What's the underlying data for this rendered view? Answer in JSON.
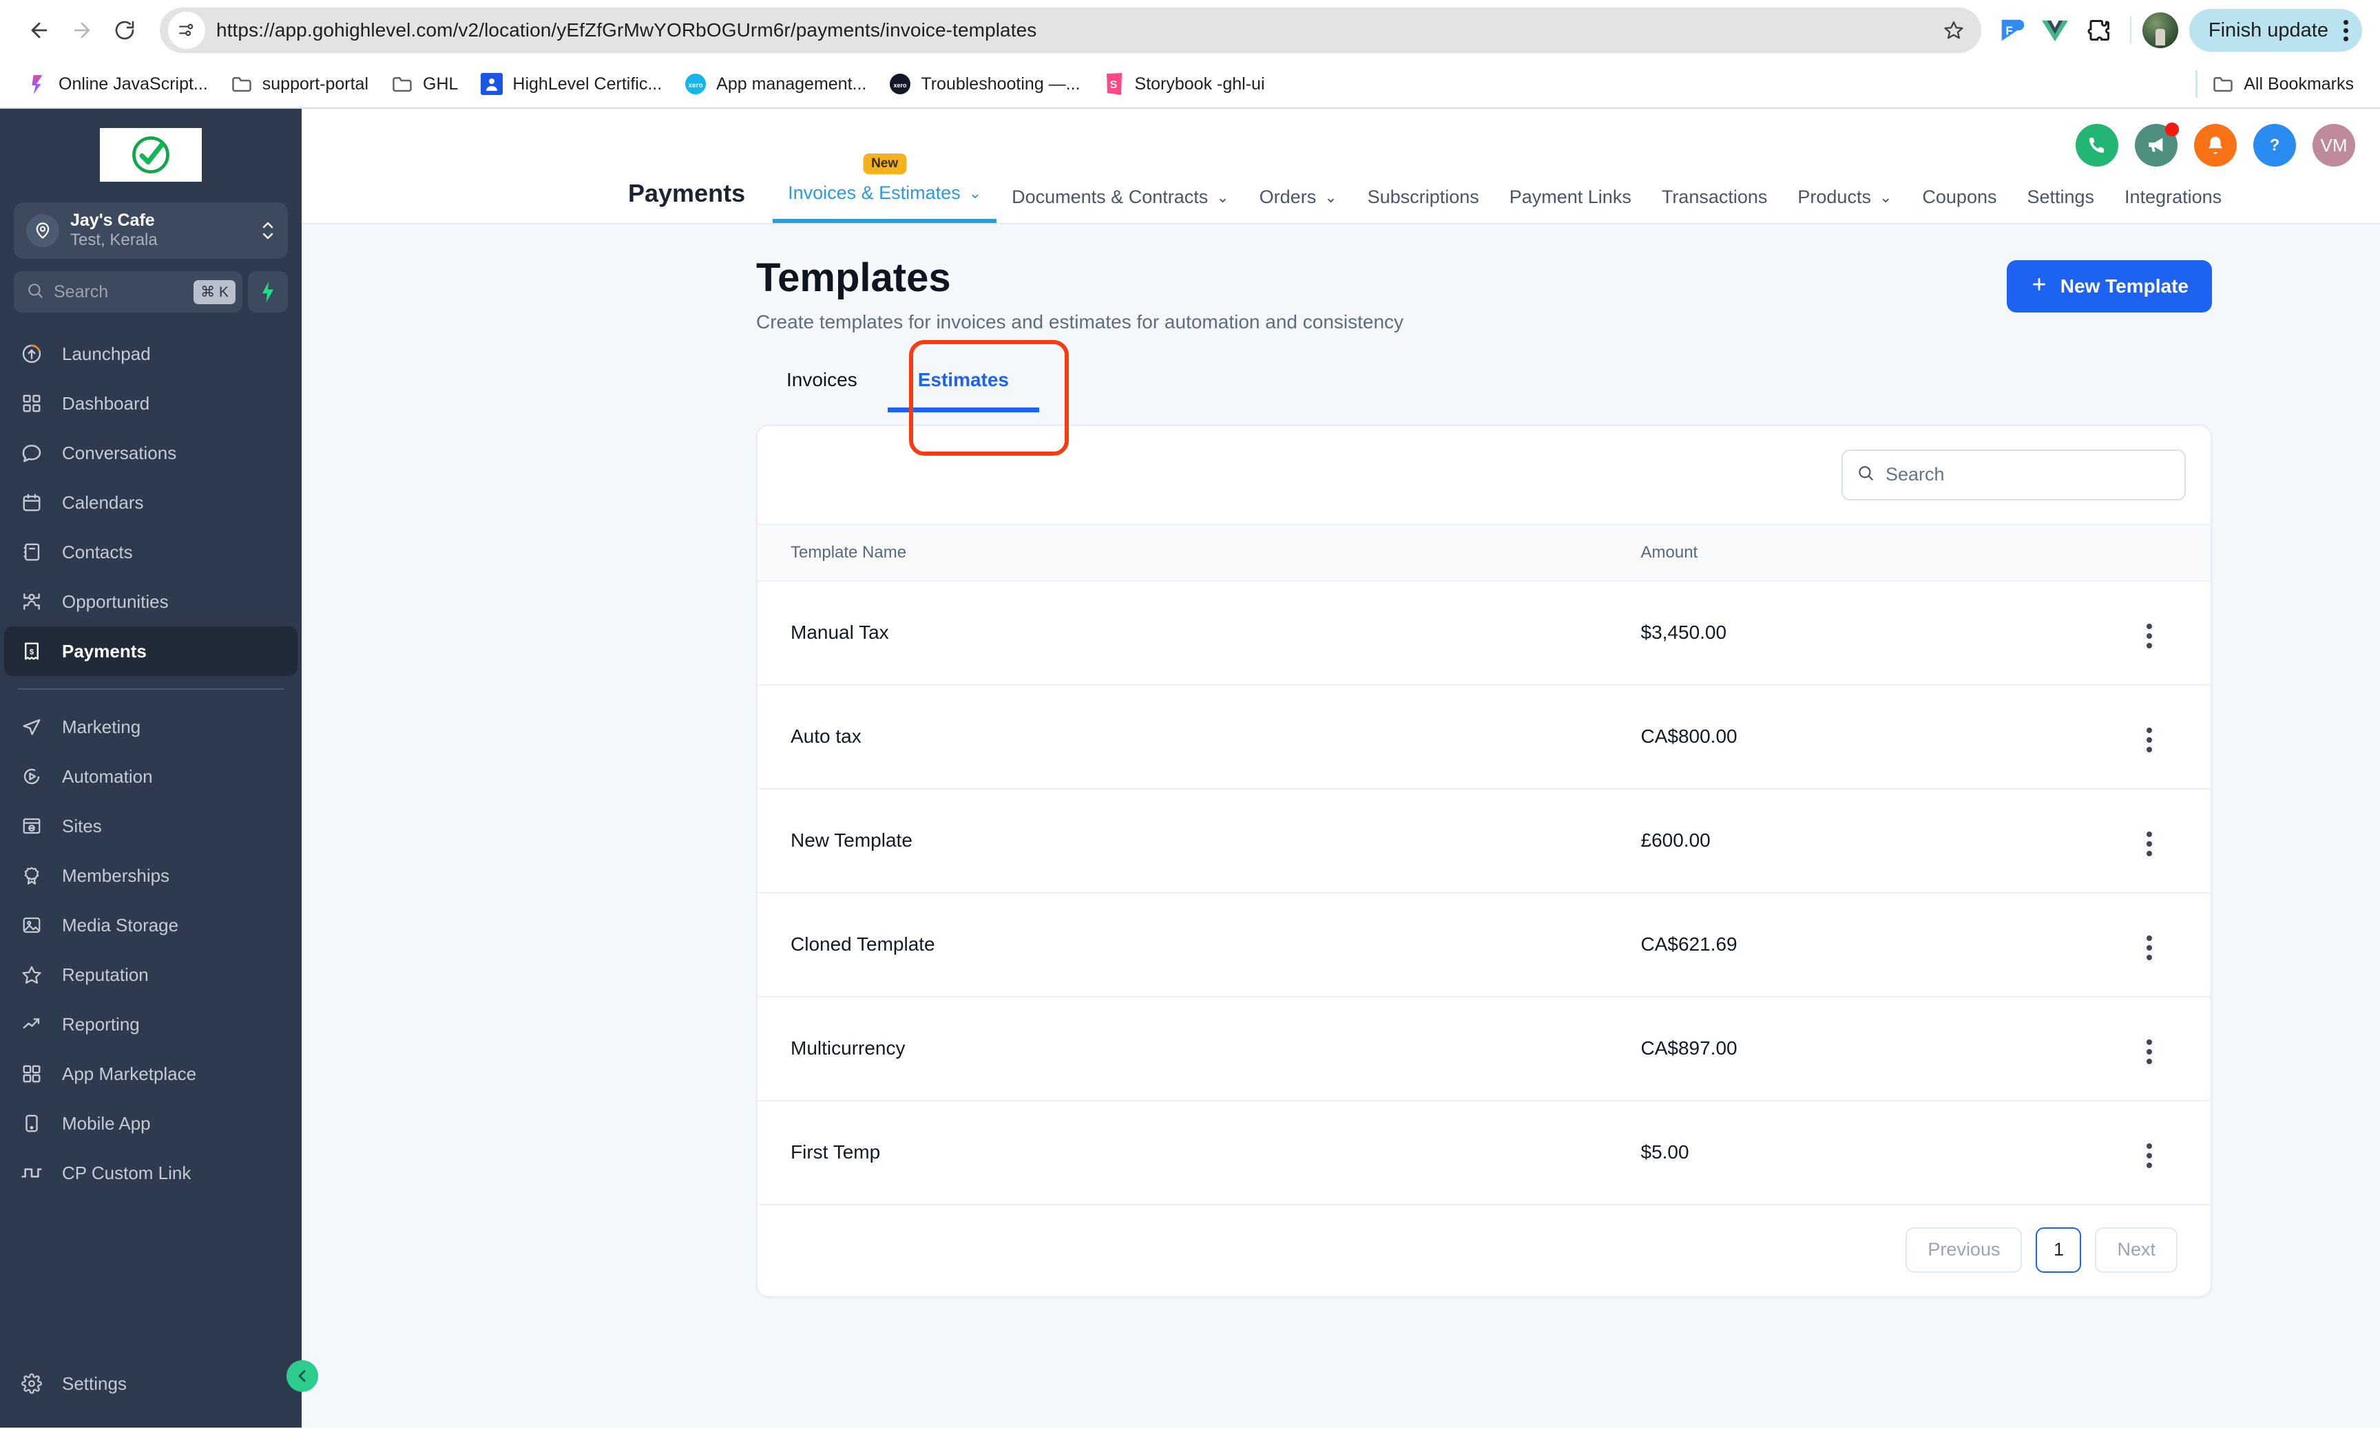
{
  "browser": {
    "url": "https://app.gohighlevel.com/v2/location/yEfZfGrMwYORbOGUrm6r/payments/invoice-templates",
    "back_icon": "back-arrow-icon",
    "forward_icon": "forward-arrow-icon",
    "reload_icon": "reload-icon",
    "site_info_icon": "site-settings-icon",
    "bookmark_star_icon": "bookmark-star-icon",
    "finish_update_label": "Finish update",
    "extensions": [
      {
        "name": "figma-extension-icon",
        "glyph": "F"
      },
      {
        "name": "vue-devtools-icon",
        "glyph": "V"
      },
      {
        "name": "extensions-puzzle-icon",
        "glyph": "puzzle"
      }
    ],
    "bookmarks": [
      {
        "label": "Online JavaScript...",
        "icon": "js-playground-icon"
      },
      {
        "label": "support-portal",
        "icon": "folder-icon"
      },
      {
        "label": "GHL",
        "icon": "folder-icon"
      },
      {
        "label": "HighLevel Certific...",
        "icon": "highlevel-icon"
      },
      {
        "label": "App management...",
        "icon": "xero-icon"
      },
      {
        "label": "Troubleshooting —...",
        "icon": "xero-dark-icon"
      },
      {
        "label": "Storybook -ghl-ui",
        "icon": "storybook-icon"
      }
    ],
    "all_bookmarks_label": "All Bookmarks",
    "all_bookmarks_icon": "folder-icon"
  },
  "sidebar": {
    "logo_icon": "green-check-circle-logo",
    "location": {
      "name": "Jay's Cafe",
      "sub": "Test, Kerala",
      "avatar_icon": "location-pin-icon",
      "chevron_icon": "chevron-up-down-icon"
    },
    "search": {
      "placeholder": "Search",
      "icon": "search-icon",
      "shortcut": "⌘ K",
      "bolt_icon": "lightning-bolt-icon"
    },
    "items": [
      {
        "label": "Launchpad",
        "icon": "launchpad-icon",
        "active": false
      },
      {
        "label": "Dashboard",
        "icon": "dashboard-grid-icon",
        "active": false
      },
      {
        "label": "Conversations",
        "icon": "chat-bubble-icon",
        "active": false
      },
      {
        "label": "Calendars",
        "icon": "calendar-icon",
        "active": false
      },
      {
        "label": "Contacts",
        "icon": "contacts-book-icon",
        "active": false
      },
      {
        "label": "Opportunities",
        "icon": "opportunities-icon",
        "active": false
      },
      {
        "label": "Payments",
        "icon": "payments-receipt-icon",
        "active": true
      }
    ],
    "items2": [
      {
        "label": "Marketing",
        "icon": "paper-plane-icon",
        "active": false
      },
      {
        "label": "Automation",
        "icon": "play-circle-icon",
        "active": false
      },
      {
        "label": "Sites",
        "icon": "browser-window-icon",
        "active": false
      },
      {
        "label": "Memberships",
        "icon": "award-ribbon-icon",
        "active": false
      },
      {
        "label": "Media Storage",
        "icon": "image-icon",
        "active": false
      },
      {
        "label": "Reputation",
        "icon": "star-icon",
        "active": false
      },
      {
        "label": "Reporting",
        "icon": "trend-up-icon",
        "active": false
      },
      {
        "label": "App Marketplace",
        "icon": "grid-apps-icon",
        "active": false
      },
      {
        "label": "Mobile App",
        "icon": "mobile-phone-icon",
        "active": false
      },
      {
        "label": "CP Custom Link",
        "icon": "custom-link-icon",
        "active": false
      }
    ],
    "settings": {
      "label": "Settings",
      "icon": "gear-icon"
    },
    "collapse_icon": "chevron-left-icon"
  },
  "topbar": {
    "icons": [
      {
        "name": "phone-icon",
        "color": "#22b573"
      },
      {
        "name": "megaphone-icon",
        "color": "#4f8f80",
        "badge": true
      },
      {
        "name": "bell-icon",
        "color": "#f97316"
      },
      {
        "name": "help-question-icon",
        "color": "#2a8cf0"
      }
    ],
    "avatar_initials": "VM",
    "avatar_color": "#bf8a9b"
  },
  "paynav": {
    "title": "Payments",
    "tabs": [
      {
        "label": "Invoices & Estimates",
        "caret": true,
        "active": true,
        "badge": "New"
      },
      {
        "label": "Documents & Contracts",
        "caret": true,
        "active": false
      },
      {
        "label": "Orders",
        "caret": true,
        "active": false
      },
      {
        "label": "Subscriptions",
        "caret": false,
        "active": false
      },
      {
        "label": "Payment Links",
        "caret": false,
        "active": false
      },
      {
        "label": "Transactions",
        "caret": false,
        "active": false
      },
      {
        "label": "Products",
        "caret": true,
        "active": false
      },
      {
        "label": "Coupons",
        "caret": false,
        "active": false
      },
      {
        "label": "Settings",
        "caret": false,
        "active": false
      },
      {
        "label": "Integrations",
        "caret": false,
        "active": false
      }
    ]
  },
  "page": {
    "title": "Templates",
    "subtitle": "Create templates for invoices and estimates for automation and consistency",
    "new_template_label": "New Template",
    "plus_icon": "plus-icon",
    "tabs": [
      {
        "label": "Invoices",
        "active": false
      },
      {
        "label": "Estimates",
        "active": true
      }
    ],
    "annotation": {
      "target": "Estimates",
      "color": "#fb3a10"
    }
  },
  "table": {
    "search_placeholder": "Search",
    "search_icon": "search-icon",
    "columns": [
      "Template Name",
      "Amount",
      ""
    ],
    "rows": [
      {
        "name": "Manual Tax",
        "amount": "$3,450.00",
        "menu_icon": "kebab-menu-icon"
      },
      {
        "name": "Auto tax",
        "amount": "CA$800.00",
        "menu_icon": "kebab-menu-icon"
      },
      {
        "name": "New Template",
        "amount": "£600.00",
        "menu_icon": "kebab-menu-icon"
      },
      {
        "name": "Cloned Template",
        "amount": "CA$621.69",
        "menu_icon": "kebab-menu-icon"
      },
      {
        "name": "Multicurrency",
        "amount": "CA$897.00",
        "menu_icon": "kebab-menu-icon"
      },
      {
        "name": "First Temp",
        "amount": "$5.00",
        "menu_icon": "kebab-menu-icon"
      }
    ],
    "pagination": {
      "previous": "Previous",
      "next": "Next",
      "current_page": "1"
    }
  }
}
